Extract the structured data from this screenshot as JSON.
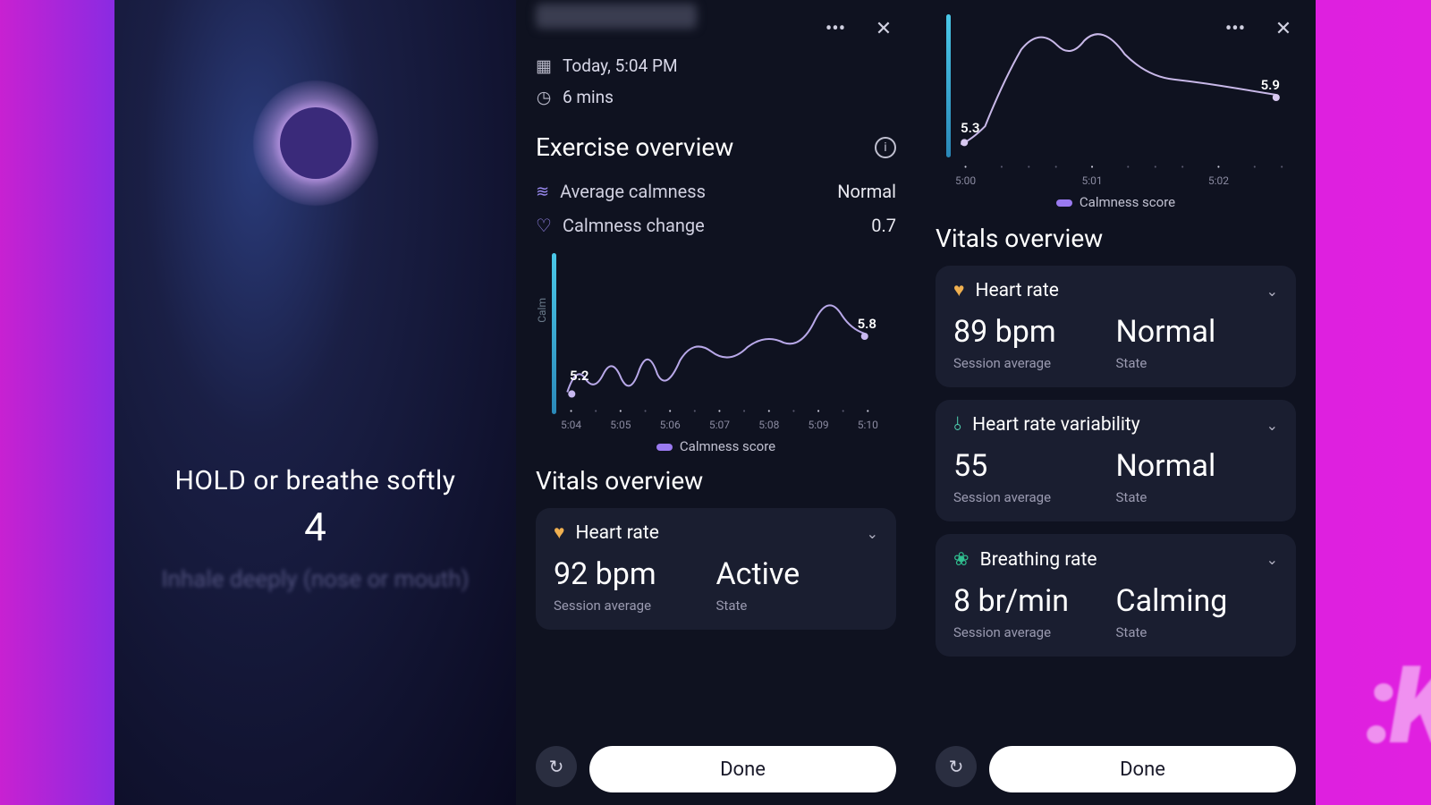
{
  "breathe": {
    "instruction": "HOLD or breathe softly",
    "count": "4",
    "next": "Inhale deeply (nose or mouth)"
  },
  "panel2": {
    "timestamp": "Today, 5:04 PM",
    "duration": "6 mins",
    "overview_title": "Exercise overview",
    "avg_calm_label": "Average calmness",
    "avg_calm_value": "Normal",
    "change_label": "Calmness change",
    "change_value": "0.7",
    "chart_legend": "Calmness score",
    "vitals_title": "Vitals overview",
    "heart_rate": {
      "title": "Heart rate",
      "value": "92 bpm",
      "value_label": "Session average",
      "state": "Active",
      "state_label": "State"
    },
    "done": "Done"
  },
  "panel3": {
    "chart_legend": "Calmness score",
    "vitals_title": "Vitals overview",
    "heart_rate": {
      "title": "Heart rate",
      "value": "89 bpm",
      "value_label": "Session average",
      "state": "Normal",
      "state_label": "State"
    },
    "hrv": {
      "title": "Heart rate variability",
      "value": "55",
      "value_label": "Session average",
      "state": "Normal",
      "state_label": "State"
    },
    "breathing": {
      "title": "Breathing rate",
      "value": "8 br/min",
      "value_label": "Session average",
      "state": "Calming",
      "state_label": "State"
    },
    "done": "Done"
  },
  "chart_data": [
    {
      "type": "line",
      "title": "Calmness score (panel 2)",
      "series": [
        {
          "name": "Calmness score",
          "values": [
            5.2,
            5.4,
            5.1,
            5.5,
            5.2,
            5.6,
            5.3,
            5.5,
            5.4,
            5.6,
            5.5,
            5.6,
            5.7,
            5.9,
            5.7,
            5.8
          ]
        }
      ],
      "x": [
        "5:04",
        "",
        "5:05",
        "",
        "5:06",
        "",
        "5:07",
        "",
        "5:08",
        "",
        "5:09",
        "",
        "5:10"
      ],
      "labeled_points": {
        "start": 5.2,
        "end": 5.8
      },
      "ylabel": "Calm",
      "ylim": [
        5.0,
        6.0
      ]
    },
    {
      "type": "line",
      "title": "Calmness score (panel 3)",
      "series": [
        {
          "name": "Calmness score",
          "values": [
            5.3,
            5.4,
            6.0,
            6.2,
            6.0,
            6.15,
            5.95,
            5.9,
            5.92,
            5.88,
            5.9
          ]
        }
      ],
      "x": [
        "5:00",
        "",
        "5:01",
        "",
        "5:02"
      ],
      "labeled_points": {
        "start": 5.3,
        "end": 5.9
      },
      "ylim": [
        5.0,
        6.3
      ]
    }
  ]
}
